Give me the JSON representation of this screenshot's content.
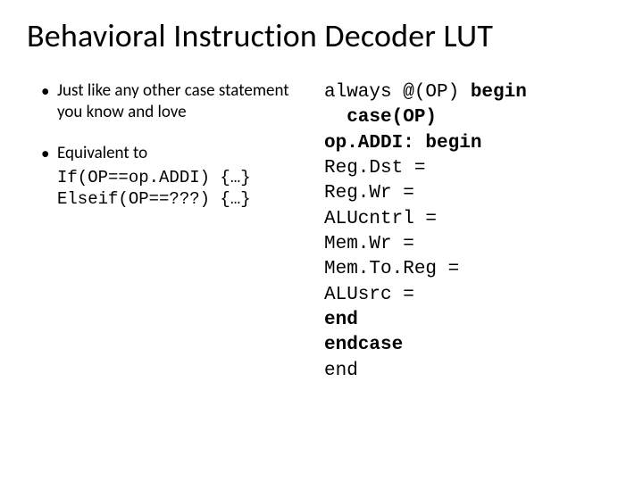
{
  "title": "Behavioral Instruction Decoder LUT",
  "left": {
    "bullet1": "Just like any other case statement you know and love",
    "bullet2": "Equivalent to",
    "code_if": "If(OP==op.ADDI) {…}",
    "code_elseif": "Elseif(OP==???) {…}"
  },
  "right": {
    "l1a": "always @(OP) ",
    "l1b": "begin",
    "l2": "  case(OP)",
    "l3": "op.ADDI: begin",
    "l4": "Reg.Dst =",
    "l5": "Reg.Wr =",
    "l6": "ALUcntrl =",
    "l7": "Mem.Wr =",
    "l8": "Mem.To.Reg =",
    "l9": "ALUsrc =",
    "l10": "end",
    "l11": "endcase",
    "l12": "end"
  }
}
